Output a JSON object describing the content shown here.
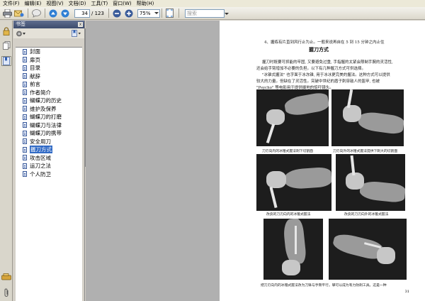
{
  "menu": {
    "items": [
      "文件(F)",
      "编辑(E)",
      "视图(V)",
      "文档(D)",
      "工具(T)",
      "窗口(W)",
      "帮助(H)"
    ]
  },
  "toolbar": {
    "page_number": "34",
    "page_total": "/ 123",
    "zoom": "75%",
    "search_placeholder": "搜索"
  },
  "panel": {
    "title": "书签",
    "close_glyph": "x",
    "bookmarks": [
      {
        "label": "封面",
        "selected": false
      },
      {
        "label": "扉页",
        "selected": false
      },
      {
        "label": "目录",
        "selected": false
      },
      {
        "label": "献辞",
        "selected": false
      },
      {
        "label": "前言",
        "selected": false
      },
      {
        "label": "作者简介",
        "selected": false
      },
      {
        "label": "蝴蝶刀的历史",
        "selected": false
      },
      {
        "label": "维护及保养",
        "selected": false
      },
      {
        "label": "蝴蝶刀的打磨",
        "selected": false
      },
      {
        "label": "蝴蝶刀与法律",
        "selected": false
      },
      {
        "label": "蝴蝶刀的携带",
        "selected": false
      },
      {
        "label": "安全用刀",
        "selected": false
      },
      {
        "label": "握刀方式",
        "selected": true
      },
      {
        "label": "攻击区域",
        "selected": false
      },
      {
        "label": "运刀之法",
        "selected": false
      },
      {
        "label": "个人防卫",
        "selected": false
      }
    ]
  },
  "document": {
    "lead_line": "4、握练有片直到风行止为止。一般来说再自在 5 到 15 分钟之内止住",
    "heading": "握刀方式",
    "para1": "握刀时既要可抓能的牢固, 又要避免过重, 手指握的太紧会限制手腕的灵活性,",
    "para2": "还会给手臂增加不必要的负担。以下有几种握刀方式可供选择。",
    "para3": "\"冰锥式握法\" 也字面于冰冻锥, 用于冰冰更完美的握法。这种方式可以提供",
    "para4": "较大的力量。但缺在了灵活性。突破中世纪的盾子刺穿敌人的盔甲, 也被",
    "para5": "\"Psycho\" 等电影用于提供摄地的惊吓镜头。",
    "captions": [
      "刀刃向内的冰锥式握法刺下切割面",
      "刀刃向外的冰锥式握法提供下刺大的切割面",
      "改良的刀刃向内的冰锥式握法",
      "改良的刀刃向外的冰锥式握法",
      "把刀刃向内的冰锥式握法改为刀锋与手臂平行。攀可以成为有力防刺工具。这是一种"
    ],
    "page_number": "31"
  }
}
